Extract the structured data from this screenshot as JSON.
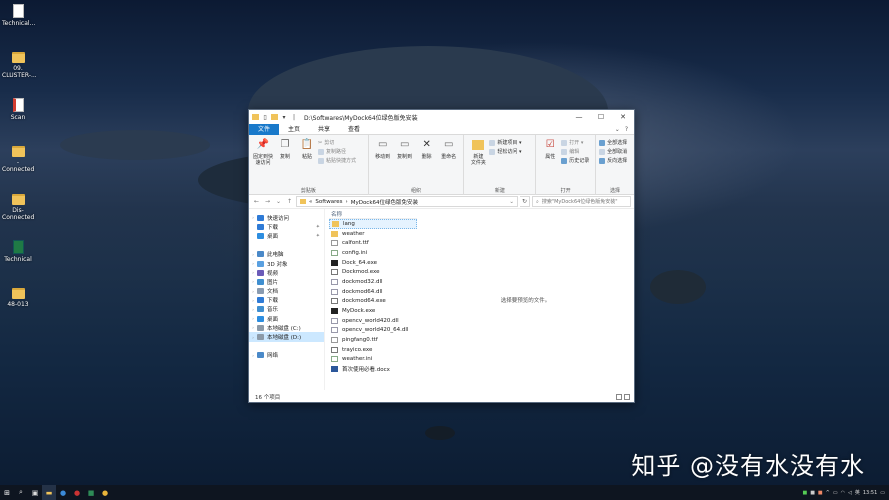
{
  "desktop": {
    "icons": [
      {
        "label": "Technical...",
        "kind": "doc"
      },
      {
        "label": "09.\nCLUSTER-...",
        "kind": "folder"
      },
      {
        "label": "Scan",
        "kind": "pdf"
      },
      {
        "label": "-Connected",
        "kind": "folder"
      },
      {
        "label": "Dis-\nConnected",
        "kind": "folder"
      },
      {
        "label": "Technical",
        "kind": "excel"
      },
      {
        "label": "48-013",
        "kind": "folder"
      }
    ],
    "watermark": "知乎 @没有水没有水"
  },
  "window": {
    "title": "D:\\Softwares\\MyDock64位绿色版免安装",
    "tabs": [
      "文件",
      "主页",
      "共享",
      "查看"
    ],
    "ribbon": {
      "clipboard": {
        "label": "剪贴板",
        "pin": "固定到快速访问",
        "copy": "复制",
        "paste": "粘贴",
        "cut": "剪切",
        "copy_path": "复制路径",
        "paste_shortcut": "粘贴快捷方式"
      },
      "organize": {
        "label": "组织",
        "move_to": "移动到",
        "copy_to": "复制到",
        "delete": "删除",
        "rename": "重命名"
      },
      "new": {
        "label": "新建",
        "new_folder": "新建\n文件夹",
        "new_item": "新建项目 ▾",
        "easy_access": "轻松访问 ▾"
      },
      "open": {
        "label": "打开",
        "properties": "属性",
        "open": "打开 ▾",
        "edit": "编辑",
        "history": "历史记录"
      },
      "select": {
        "label": "选择",
        "select_all": "全部选择",
        "select_none": "全部取消",
        "invert": "反向选择"
      }
    },
    "address": {
      "segments": [
        "«",
        "Softwares",
        "›",
        "MyDock64位绿色版免安装"
      ]
    },
    "search_placeholder": "搜索\"MyDock64位绿色版免安装\"",
    "nav_pane": [
      {
        "label": "快速访问",
        "icon": "star-icon",
        "color": "#2f7bd6",
        "pinned": false,
        "expand": true
      },
      {
        "label": "下载",
        "icon": "download-icon",
        "color": "#2f7bd6",
        "pinned": true,
        "expand": false
      },
      {
        "label": "桌面",
        "icon": "desktop-icon",
        "color": "#2d8ee0",
        "pinned": true,
        "expand": false
      },
      {
        "label": "",
        "icon": "",
        "color": "",
        "pinned": false,
        "expand": false
      },
      {
        "label": "此电脑",
        "icon": "computer-icon",
        "color": "#4a89c8",
        "pinned": false,
        "expand": true
      },
      {
        "label": "3D 对象",
        "icon": "3d-objects-icon",
        "color": "#5aa0e0",
        "pinned": false,
        "expand": true
      },
      {
        "label": "视频",
        "icon": "video-icon",
        "color": "#6b5bb8",
        "pinned": false,
        "expand": true
      },
      {
        "label": "图片",
        "icon": "pictures-icon",
        "color": "#3f8fd0",
        "pinned": false,
        "expand": true
      },
      {
        "label": "文档",
        "icon": "documents-icon",
        "color": "#8a9bb0",
        "pinned": false,
        "expand": true
      },
      {
        "label": "下载",
        "icon": "download-icon",
        "color": "#2f7bd6",
        "pinned": false,
        "expand": true
      },
      {
        "label": "音乐",
        "icon": "music-icon",
        "color": "#3f8fd0",
        "pinned": false,
        "expand": true
      },
      {
        "label": "桌面",
        "icon": "desktop-icon",
        "color": "#2d8ee0",
        "pinned": false,
        "expand": true
      },
      {
        "label": "本地磁盘 (C:)",
        "icon": "drive-icon",
        "color": "#8c9aa8",
        "pinned": false,
        "expand": true
      },
      {
        "label": "本地磁盘 (D:)",
        "icon": "drive-icon",
        "color": "#8c9aa8",
        "pinned": false,
        "expand": true,
        "selected": true
      },
      {
        "label": "",
        "icon": "",
        "color": "",
        "pinned": false,
        "expand": false
      },
      {
        "label": "网络",
        "icon": "network-icon",
        "color": "#4a89c8",
        "pinned": false,
        "expand": true
      }
    ],
    "column_header": "名称",
    "files": [
      {
        "name": "lang",
        "type": "folder",
        "selected": true
      },
      {
        "name": "weather",
        "type": "folder"
      },
      {
        "name": "calfont.ttf",
        "type": "font"
      },
      {
        "name": "config.ini",
        "type": "ini"
      },
      {
        "name": "Dock_64.exe",
        "type": "exe-dark"
      },
      {
        "name": "Dockmod.exe",
        "type": "exe-tool"
      },
      {
        "name": "dockmod32.dll",
        "type": "dll"
      },
      {
        "name": "dockmod64.dll",
        "type": "dll"
      },
      {
        "name": "dockmod64.exe",
        "type": "exe-tool"
      },
      {
        "name": "MyDock.exe",
        "type": "exe-dark"
      },
      {
        "name": "opencv_world420.dll",
        "type": "dll"
      },
      {
        "name": "opencv_world420_64.dll",
        "type": "dll"
      },
      {
        "name": "pingfang0.ttf",
        "type": "font"
      },
      {
        "name": "trayico.exe",
        "type": "exe-tool"
      },
      {
        "name": "weather.ini",
        "type": "ini"
      },
      {
        "name": "首次使用必看.docx",
        "type": "docx"
      }
    ],
    "preview_text": "选择要预览的文件。",
    "status": "16 个项目"
  },
  "taskbar": {
    "time": "13:51",
    "lang": "英"
  }
}
